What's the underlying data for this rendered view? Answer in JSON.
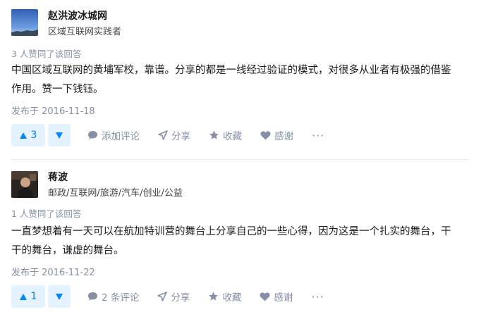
{
  "answers": [
    {
      "author": {
        "name": "赵洪波冰城网",
        "headline": "区域互联网实践者"
      },
      "votes_text": "3 人赞同了该回答",
      "content_lines": [
        "中国区域互联网的黄埔军校，靠谱。分享的都是一线经过验证的模式，对很多从业者有极强的借鉴",
        "作用。赞一下钱钰。"
      ],
      "date": "发布于 2016-11-18",
      "vote_count": "3",
      "comment_label": "添加评论",
      "share_label": "分享",
      "collect_label": "收藏",
      "thanks_label": "感谢",
      "more_label": "···"
    },
    {
      "author": {
        "name": "蒋波",
        "headline": "邮政/互联网/旅游/汽车/创业/公益"
      },
      "votes_text": "1 人赞同了该回答",
      "content_lines": [
        "一直梦想着有一天可以在航加特训营的舞台上分享自己的一些心得，因为这是一个扎实的舞台，干",
        "干的舞台，谦虚的舞台。"
      ],
      "date": "发布于 2016-11-22",
      "vote_count": "1",
      "comment_label": "2 条评论",
      "share_label": "分享",
      "collect_label": "收藏",
      "thanks_label": "感谢",
      "more_label": "···"
    }
  ],
  "colors": {
    "accent": "#0084ff",
    "accent_bg": "#e5f2ff",
    "meta": "#8590a6"
  },
  "icons": [
    "triangle-up-icon",
    "triangle-down-icon",
    "comment-icon",
    "share-icon",
    "star-icon",
    "heart-icon",
    "more-icon"
  ]
}
